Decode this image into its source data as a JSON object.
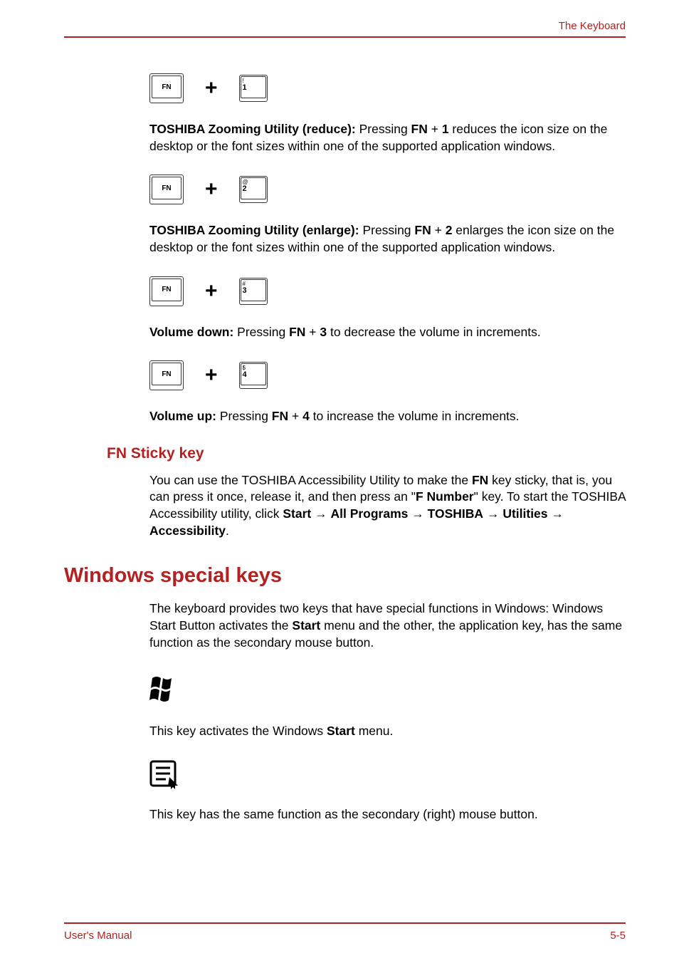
{
  "header": {
    "right": "The Keyboard"
  },
  "combo1": {
    "fn": "FN",
    "plus": "+",
    "keyTop": "!",
    "keyMain": "1",
    "keySub": ""
  },
  "para1": {
    "bold": "TOSHIBA Zooming Utility (reduce): ",
    "pre": "Pressing ",
    "fn": "FN",
    "plus": " + ",
    "num": "1",
    "post": " reduces the icon size on the desktop or the font sizes within one of the supported application windows."
  },
  "combo2": {
    "fn": "FN",
    "plus": "+",
    "keyTop": "@",
    "keyMain": "2",
    "keySub": ""
  },
  "para2": {
    "bold": "TOSHIBA Zooming Utility (enlarge): ",
    "pre": "Pressing ",
    "fn": "FN",
    "plus": " + ",
    "num": "2",
    "post": " enlarges the icon size on the desktop or the font sizes within one of the supported application windows."
  },
  "combo3": {
    "fn": "FN",
    "plus": "+",
    "keyTop": "#",
    "keyMain": "3",
    "keySub": ""
  },
  "para3": {
    "bold": "Volume down: ",
    "pre": "Pressing ",
    "fn": "FN",
    "plus": " + ",
    "num": "3",
    "post": " to decrease the volume in increments."
  },
  "combo4": {
    "fn": "FN",
    "plus": "+",
    "keyTop": "$",
    "keyMain": "4",
    "keySub": ""
  },
  "para4": {
    "bold": "Volume up: ",
    "pre": "Pressing ",
    "fn": "FN",
    "plus": " + ",
    "num": "4",
    "post": " to increase the volume in increments."
  },
  "h3_sticky": "FN Sticky key",
  "sticky": {
    "text1": "You can use the TOSHIBA Accessibility Utility to make the ",
    "fn": "FN",
    "text2": " key sticky, that is, you can press it once, release it, and then press an \"",
    "fnum": "F Number",
    "text3": "\" key. To start the TOSHIBA Accessibility utility, click ",
    "start": "Start",
    "arrow1": " → ",
    "all": "All Programs",
    "arrow2": " → ",
    "toshiba": "TOSHIBA",
    "arrow3": " → ",
    "utilities": "Utilities",
    "arrow4": " → ",
    "access": "Accessibility",
    "period": "."
  },
  "h2_win": "Windows special keys",
  "winpara": {
    "text1": "The keyboard provides two keys that have special functions in Windows: Windows Start Button activates the ",
    "start": "Start",
    "text2": " menu and the other, the application key, has the same function as the secondary mouse button."
  },
  "winkey": {
    "text1": "This key activates the Windows ",
    "start": "Start",
    "text2": " menu."
  },
  "appkey": {
    "text": "This key has the same function as the secondary (right) mouse button."
  },
  "footer": {
    "left": "User's Manual",
    "right": "5-5"
  }
}
